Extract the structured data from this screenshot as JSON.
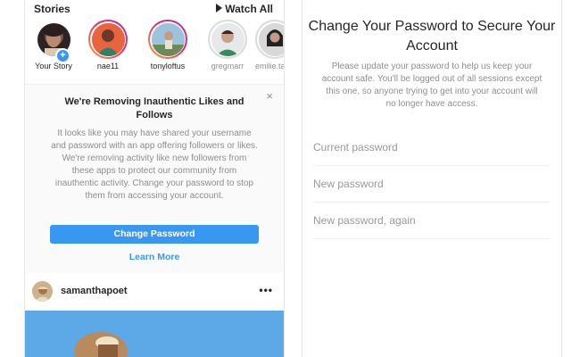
{
  "stories": {
    "title": "Stories",
    "watch_all": "Watch All",
    "items": [
      {
        "name": "Your Story"
      },
      {
        "name": "nae11"
      },
      {
        "name": "tonyloftus"
      },
      {
        "name": "gregmarr"
      },
      {
        "name": "emilie.ta"
      }
    ],
    "colors": {
      "ring_start": "#f9a13b",
      "ring_mid": "#e1306c",
      "ring_end": "#a137b8"
    }
  },
  "notice": {
    "title": "We're Removing Inauthentic Likes and Follows",
    "body": "It looks like you may have shared your username and password with an app offering followers or likes. We're removing activity like new followers from these apps to protect our community from inauthentic activity. Change your password to stop them from accessing your account.",
    "close": "×",
    "change_password": "Change Password",
    "learn_more": "Learn More",
    "accent": "#3897f0"
  },
  "post": {
    "username": "samanthapoet",
    "more": "•••"
  },
  "change_password_page": {
    "title": "Change Your Password to Secure Your Account",
    "description": "Please update your password to help us keep your account safe. You'll be logged out of all sessions except this one, so anyone trying to get into your account will no longer have access.",
    "fields": {
      "current_placeholder": "Current password",
      "new_placeholder": "New password",
      "again_placeholder": "New password, again"
    }
  }
}
